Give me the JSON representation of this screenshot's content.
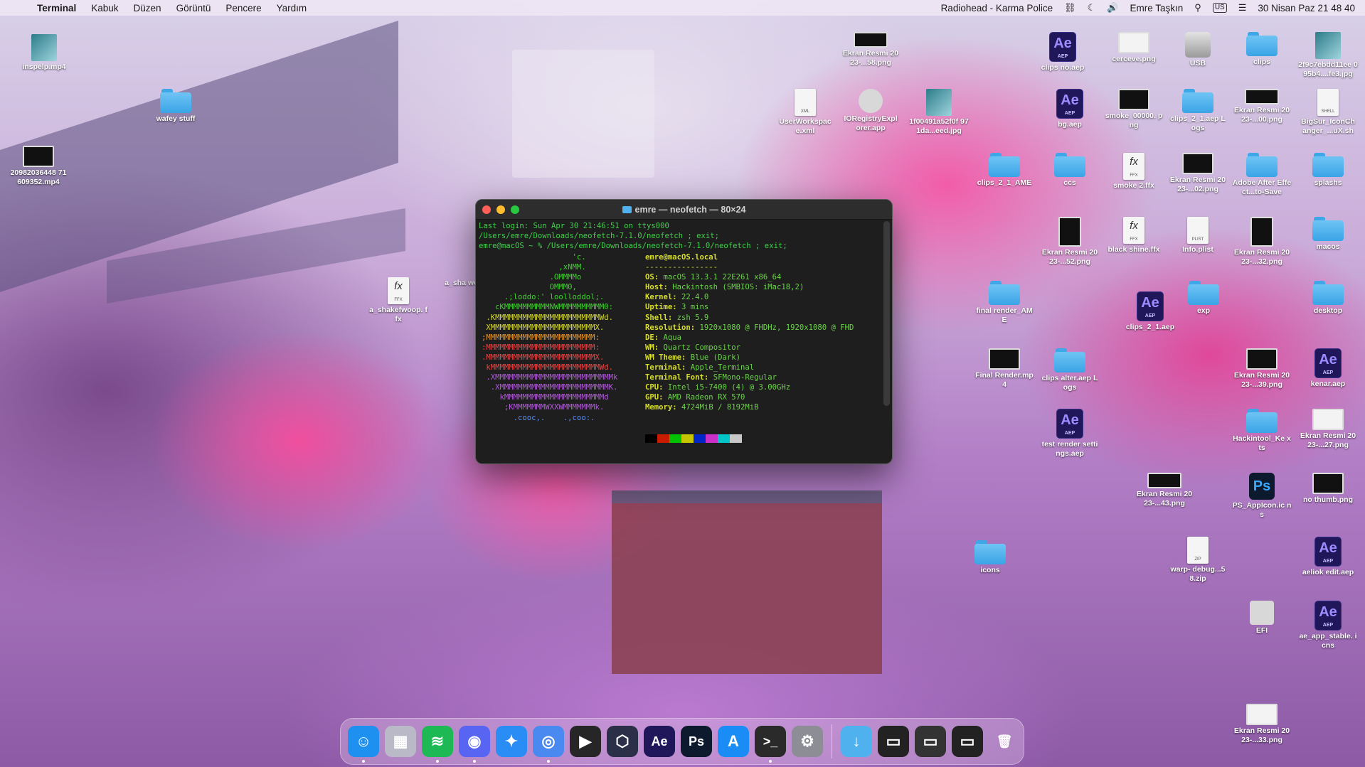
{
  "menubar": {
    "app_name": "Terminal",
    "menus": [
      "Kabuk",
      "Düzen",
      "Görüntü",
      "Pencere",
      "Yardım"
    ],
    "now_playing": "Radiohead - Karma Police",
    "user": "Emre Taşkın",
    "input_source": "US",
    "clock": "30 Nisan Paz  21 48 40"
  },
  "terminal": {
    "title": "emre — neofetch — 80×24",
    "login_lines": [
      "Last login: Sun Apr 30 21:46:51 on ttys000",
      "/Users/emre/Downloads/neofetch-7.1.0/neofetch ; exit;",
      "emre@macOS ~ % /Users/emre/Downloads/neofetch-7.1.0/neofetch ; exit;"
    ],
    "ascii": [
      {
        "text": "                    'c.",
        "color": "green"
      },
      {
        "text": "                 ,xNMM.",
        "color": "green"
      },
      {
        "text": "               .OMMMMo",
        "color": "green"
      },
      {
        "text": "               OMMM0,",
        "color": "green"
      },
      {
        "text": "     .;loddo:' loolloddol;.",
        "color": "green"
      },
      {
        "text": "   cKMMMMMMMMMMNWMMMMMMMMMM0:",
        "color": "green"
      },
      {
        "text": " .KMMMMMMMMMMMMMMMMMMMMMMMWd.",
        "color": "yellow"
      },
      {
        "text": " XMMMMMMMMMMMMMMMMMMMMMMMX.",
        "color": "yellow"
      },
      {
        "text": ";MMMMMMMMMMMMMMMMMMMMMMMM:",
        "color": "orange"
      },
      {
        "text": ":MMMMMMMMMMMMMMMMMMMMMMMM:",
        "color": "red"
      },
      {
        "text": ".MMMMMMMMMMMMMMMMMMMMMMMMX.",
        "color": "red"
      },
      {
        "text": " kMMMMMMMMMMMMMMMMMMMMMMMMWd.",
        "color": "red"
      },
      {
        "text": " .XMMMMMMMMMMMMMMMMMMMMMMMMMMk",
        "color": "purple"
      },
      {
        "text": "  .XMMMMMMMMMMMMMMMMMMMMMMMMK.",
        "color": "purple"
      },
      {
        "text": "    kMMMMMMMMMMMMMMMMMMMMMMd",
        "color": "purple"
      },
      {
        "text": "     ;KMMMMMMMWXXWMMMMMMMk.",
        "color": "purple"
      },
      {
        "text": "       .cooc,.    .,coo:.",
        "color": "blue"
      }
    ],
    "user_host": "emre@macOS.local",
    "separator": "----------------",
    "info": [
      {
        "key": "OS",
        "value": "macOS 13.3.1 22E261 x86_64"
      },
      {
        "key": "Host",
        "value": "Hackintosh (SMBIOS: iMac18,2)"
      },
      {
        "key": "Kernel",
        "value": "22.4.0"
      },
      {
        "key": "Uptime",
        "value": "3 mins"
      },
      {
        "key": "Shell",
        "value": "zsh 5.9"
      },
      {
        "key": "Resolution",
        "value": "1920x1080 @ FHDHz, 1920x1080 @ FHD"
      },
      {
        "key": "DE",
        "value": "Aqua"
      },
      {
        "key": "WM",
        "value": "Quartz Compositor"
      },
      {
        "key": "WM Theme",
        "value": "Blue (Dark)"
      },
      {
        "key": "Terminal",
        "value": "Apple_Terminal"
      },
      {
        "key": "Terminal Font",
        "value": "SFMono-Regular"
      },
      {
        "key": "CPU",
        "value": "Intel i5-7400 (4) @ 3.00GHz"
      },
      {
        "key": "GPU",
        "value": "AMD Radeon RX 570"
      },
      {
        "key": "Memory",
        "value": "4724MiB / 8192MiB"
      }
    ],
    "palette": [
      "#000000",
      "#c91b00",
      "#00c200",
      "#c7c400",
      "#0225c7",
      "#ca30c7",
      "#00c5c7",
      "#c7c7c7"
    ]
  },
  "desktop": {
    "icons": [
      {
        "label": "inspelp.mp4",
        "kind": "thumb"
      },
      {
        "label": "wafey stuff",
        "kind": "folder"
      },
      {
        "label": "20982036448 71609352.mp4",
        "kind": "shot"
      },
      {
        "label": "a_shakefwoop. ffx",
        "kind": "ffx"
      },
      {
        "label": "a_sha wob",
        "kind": "label-only"
      },
      {
        "label": "Ekran Resmi 2023-...58.png",
        "kind": "shot-wide"
      },
      {
        "label": "UserWorkspac e.xml",
        "kind": "xml"
      },
      {
        "label": "IORegistryExpl orer.app",
        "kind": "app"
      },
      {
        "label": "1f00491a52f0f 971da...eed.jpg",
        "kind": "thumb"
      },
      {
        "label": "clips no.aep",
        "kind": "ae"
      },
      {
        "label": "cerceve.png",
        "kind": "shot-white"
      },
      {
        "label": "USB",
        "kind": "drive"
      },
      {
        "label": "clips",
        "kind": "folder"
      },
      {
        "label": "2f9c7ebdd11ee 095b4....fe3.jpg",
        "kind": "thumb"
      },
      {
        "label": "bg.aep",
        "kind": "ae"
      },
      {
        "label": "smoke_00000. png",
        "kind": "shot"
      },
      {
        "label": "clips_2_1.aep Logs",
        "kind": "folder"
      },
      {
        "label": "Ekran Resmi 2023-...00.png",
        "kind": "shot-wide"
      },
      {
        "label": "BigSur_IconCh anger_...uX.sh",
        "kind": "shell"
      },
      {
        "label": "clips_2_1_AME",
        "kind": "folder"
      },
      {
        "label": "ccs",
        "kind": "folder"
      },
      {
        "label": "smoke 2.ffx",
        "kind": "ffx"
      },
      {
        "label": "Ekran Resmi 2023-...02.png",
        "kind": "shot"
      },
      {
        "label": "Adobe After Effect...to-Save",
        "kind": "folder"
      },
      {
        "label": "splashs",
        "kind": "folder"
      },
      {
        "label": "Ekran Resmi 2023-...52.png",
        "kind": "shot-tall"
      },
      {
        "label": "black shine.ffx",
        "kind": "ffx"
      },
      {
        "label": "Info.plist",
        "kind": "plist"
      },
      {
        "label": "Ekran Resmi 2023-...32.png",
        "kind": "shot-tall"
      },
      {
        "label": "macos",
        "kind": "folder"
      },
      {
        "label": "final render_AME",
        "kind": "folder"
      },
      {
        "label": "clips_2_1.aep",
        "kind": "ae"
      },
      {
        "label": "exp",
        "kind": "folder"
      },
      {
        "label": "desktop",
        "kind": "folder"
      },
      {
        "label": "Final Render.mp4",
        "kind": "shot"
      },
      {
        "label": "clips alter.aep Logs",
        "kind": "folder"
      },
      {
        "label": "Ekran Resmi 2023-...39.png",
        "kind": "shot"
      },
      {
        "label": "kenar.aep",
        "kind": "ae"
      },
      {
        "label": "test render settings.aep",
        "kind": "ae"
      },
      {
        "label": "Hackintool_Ke xts",
        "kind": "folder"
      },
      {
        "label": "Ekran Resmi 2023-...27.png",
        "kind": "shot-white"
      },
      {
        "label": "Ekran Resmi 2023-...43.png",
        "kind": "shot-wide"
      },
      {
        "label": "PS_AppIcon.ic ns",
        "kind": "ps"
      },
      {
        "label": "no thumb.png",
        "kind": "shot"
      },
      {
        "label": "icons",
        "kind": "folder"
      },
      {
        "label": "warp- debug...58.zip",
        "kind": "zip"
      },
      {
        "label": "aeliok edit.aep",
        "kind": "ae"
      },
      {
        "label": "EFI",
        "kind": "efi"
      },
      {
        "label": "ae_app_stable. icns",
        "kind": "ae"
      },
      {
        "label": "Ekran Resmi 2023-...33.png",
        "kind": "shot-white"
      }
    ]
  },
  "dock": {
    "apps": [
      {
        "name": "finder-icon",
        "glyph": "☺",
        "bg": "#1e90f0",
        "running": true
      },
      {
        "name": "launchpad-icon",
        "glyph": "▦",
        "bg": "#b9b9c7",
        "running": false
      },
      {
        "name": "spotify-icon",
        "glyph": "≋",
        "bg": "#1db954",
        "running": true
      },
      {
        "name": "discord-icon",
        "glyph": "◉",
        "bg": "#5865f2",
        "running": true
      },
      {
        "name": "safari-icon",
        "glyph": "✦",
        "bg": "#2a8cf5",
        "running": false
      },
      {
        "name": "chrome-icon",
        "glyph": "◎",
        "bg": "#4a8af0",
        "running": true
      },
      {
        "name": "final-cut-icon",
        "glyph": "▶",
        "bg": "#262626",
        "running": false
      },
      {
        "name": "package-icon",
        "glyph": "⬡",
        "bg": "#2b2f48",
        "running": false
      },
      {
        "name": "after-effects-icon",
        "glyph": "Ae",
        "bg": "#1f1759",
        "running": false
      },
      {
        "name": "photoshop-icon",
        "glyph": "Ps",
        "bg": "#0d1a2e",
        "running": false
      },
      {
        "name": "app-store-icon",
        "glyph": "A",
        "bg": "#1a8cf5",
        "running": false
      },
      {
        "name": "terminal-icon",
        "glyph": ">_",
        "bg": "#2a2a2a",
        "running": true
      },
      {
        "name": "system-settings-icon",
        "glyph": "⚙",
        "bg": "#8d8d95",
        "running": false
      }
    ],
    "recents": [
      {
        "name": "downloads-folder-icon",
        "glyph": "↓",
        "bg": "#4fb2ee"
      },
      {
        "name": "recent-screenshot-1-icon",
        "glyph": "▭",
        "bg": "#222"
      },
      {
        "name": "recent-screenshot-2-icon",
        "glyph": "▭",
        "bg": "#333"
      },
      {
        "name": "recent-screenshot-3-icon",
        "glyph": "▭",
        "bg": "#222"
      },
      {
        "name": "trash-icon",
        "glyph": "🗑",
        "bg": "transparent"
      }
    ]
  }
}
